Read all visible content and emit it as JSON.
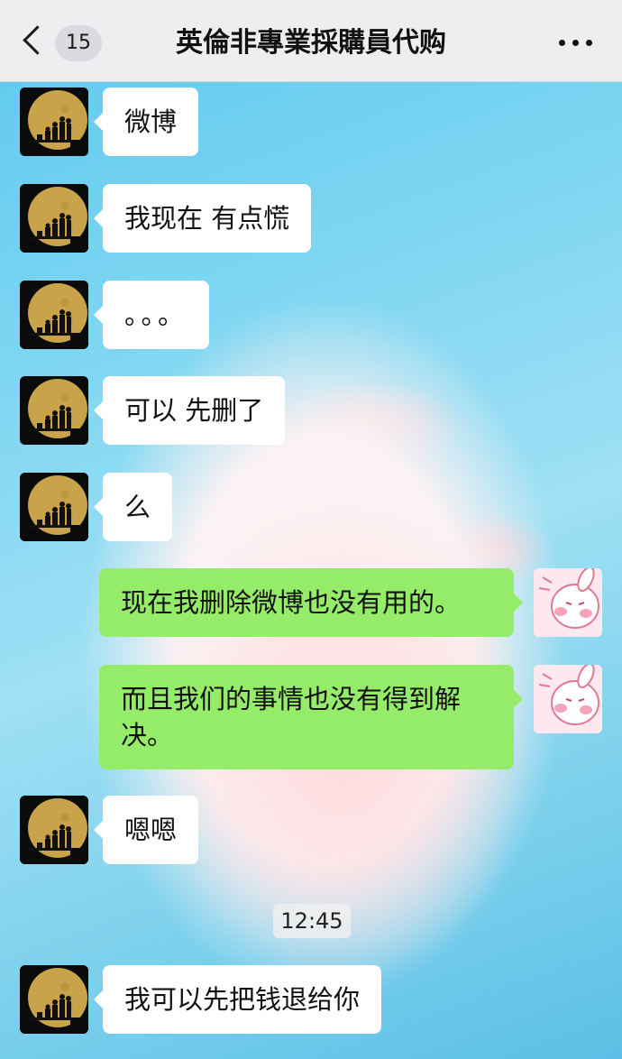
{
  "header": {
    "back_icon": "chevron-left-icon",
    "unread_count": "15",
    "title": "英倫非專業採購員代购",
    "more_icon": "more-dots-icon"
  },
  "messages": [
    {
      "side": "left",
      "text": "微博"
    },
    {
      "side": "left",
      "text": "我现在 有点慌"
    },
    {
      "side": "left",
      "text": "。。。"
    },
    {
      "side": "left",
      "text": "可以 先删了"
    },
    {
      "side": "left",
      "text": "么"
    },
    {
      "side": "right",
      "text": "现在我删除微博也没有用的。"
    },
    {
      "side": "right",
      "text": "而且我们的事情也没有得到解决。"
    },
    {
      "side": "left",
      "text": "嗯嗯"
    },
    {
      "side": "time",
      "text": "12:45"
    },
    {
      "side": "left",
      "text": "我可以先把钱退给你"
    }
  ],
  "colors": {
    "incoming_bubble": "#ffffff",
    "outgoing_bubble": "#95ec69",
    "header_bg": "#eceef0"
  }
}
